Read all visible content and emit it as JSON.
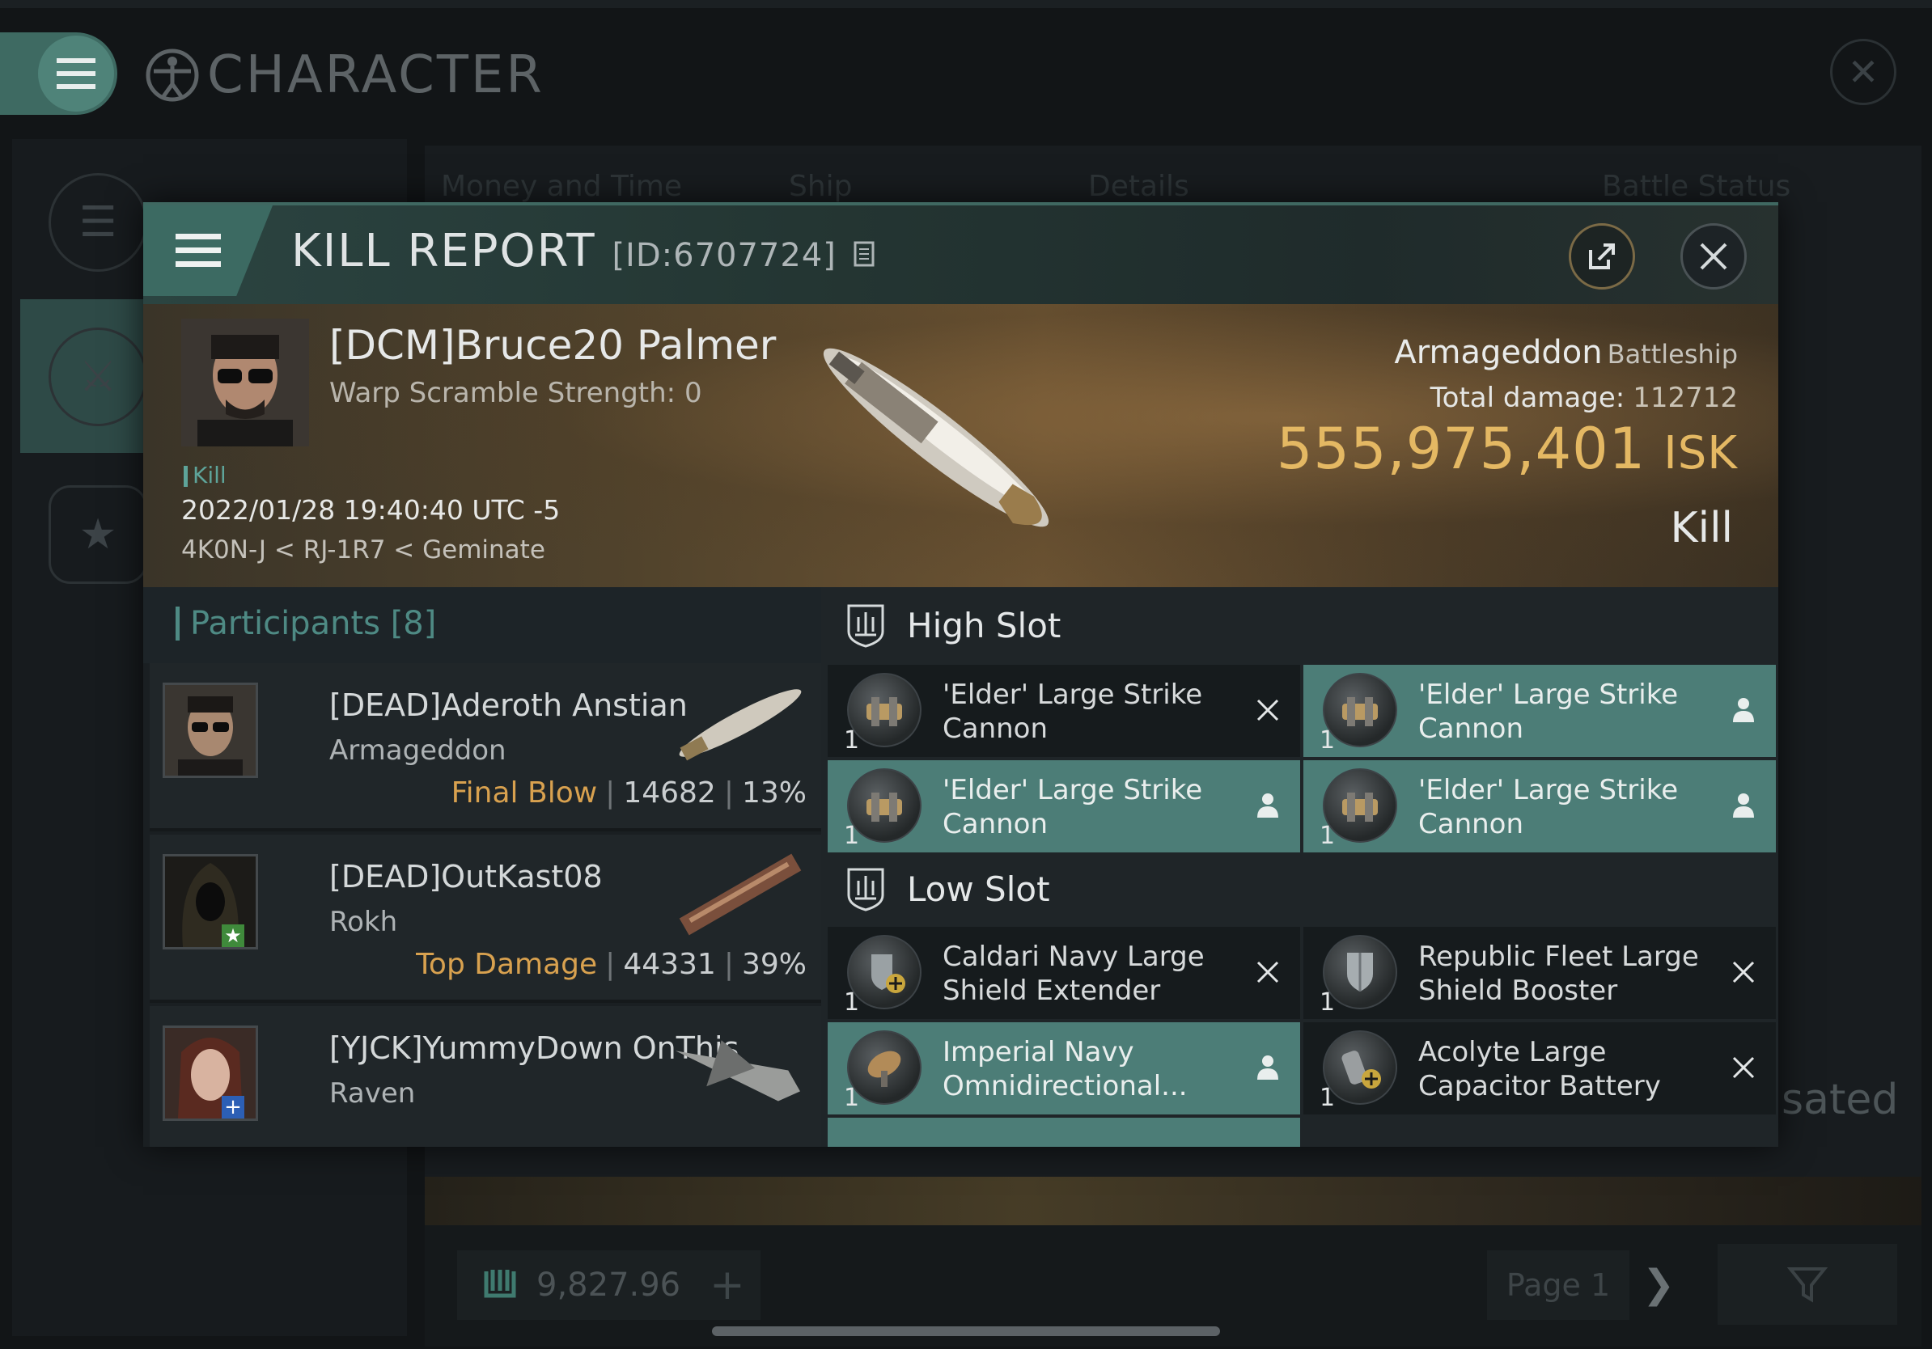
{
  "background": {
    "title": "CHARACTER",
    "tabs": [
      "Money and Time",
      "Ship",
      "Details",
      "Battle Status"
    ],
    "partial_text": "sated",
    "wallet_value": "9,827.96",
    "page_label": "Page 1"
  },
  "modal": {
    "title": "KILL REPORT",
    "report_id": "[ID:6707724]",
    "victim": {
      "name": "[DCM]Bruce20 Palmer",
      "warp_scramble": "Warp Scramble Strength: 0",
      "tag": "Kill",
      "datetime": "2022/01/28 19:40:40 UTC -5",
      "location": "4K0N-J < RJ-1R7 < Geminate",
      "ship_name": "Armageddon",
      "ship_class": "Battleship",
      "total_damage_label": "Total damage:",
      "total_damage_value": "112712",
      "isk_value": "555,975,401",
      "isk_unit": "ISK",
      "result": "Kill"
    },
    "participants": {
      "label": "Participants",
      "count": "[8]",
      "items": [
        {
          "name": "[DEAD]Aderoth Anstian",
          "ship": "Armageddon",
          "stat_label": "Final Blow",
          "damage": "14682",
          "percent": "13%"
        },
        {
          "name": "[DEAD]OutKast08",
          "ship": "Rokh",
          "stat_label": "Top Damage",
          "damage": "44331",
          "percent": "39%"
        },
        {
          "name": "[YJCK]YummyDown OnThis",
          "ship": "Raven"
        }
      ]
    },
    "high_slot": {
      "title": "High Slot",
      "modules": [
        {
          "qty": "1",
          "name": "'Elder' Large Strike Cannon",
          "status": "dropped"
        },
        {
          "qty": "1",
          "name": "'Elder' Large Strike Cannon",
          "status": "destroyed"
        },
        {
          "qty": "1",
          "name": "'Elder' Large Strike Cannon",
          "status": "destroyed"
        },
        {
          "qty": "1",
          "name": "'Elder' Large Strike Cannon",
          "status": "destroyed"
        }
      ]
    },
    "low_slot": {
      "title": "Low Slot",
      "modules": [
        {
          "qty": "1",
          "name": "Caldari Navy Large Shield Extender",
          "status": "dropped"
        },
        {
          "qty": "1",
          "name": "Republic Fleet Large Shield Booster",
          "status": "dropped"
        },
        {
          "qty": "1",
          "name": "Imperial Navy Omnidirectional...",
          "status": "destroyed"
        },
        {
          "qty": "1",
          "name": "Acolyte Large Capacitor Battery",
          "status": "dropped"
        }
      ]
    }
  },
  "colors": {
    "accent": "#4e8a84",
    "destroyed_row": "#4c7d77",
    "isk": "#e4b863",
    "stat_label": "#d8a14f"
  }
}
